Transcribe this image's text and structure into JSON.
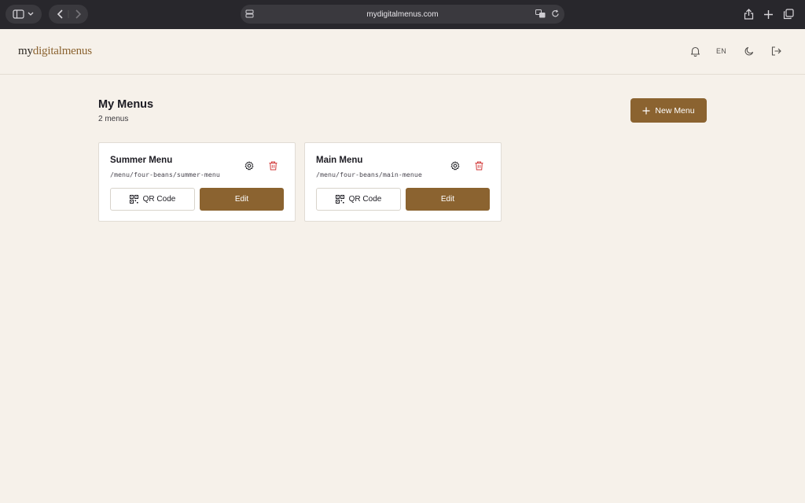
{
  "browser": {
    "url": "mydigitalmenus.com"
  },
  "header": {
    "logo_prefix": "my",
    "logo_accent": "digitalmenus",
    "language": "EN",
    "icons": [
      "bell-icon",
      "moon-icon",
      "logout-icon"
    ]
  },
  "main": {
    "title": "My Menus",
    "count_label": "2 menus",
    "new_menu_label": "New Menu"
  },
  "menus": [
    {
      "name": "Summer Menu",
      "path": "/menu/four-beans/summer-menu",
      "qr_label": "QR Code",
      "edit_label": "Edit"
    },
    {
      "name": "Main Menu",
      "path": "/menu/four-beans/main-menue",
      "qr_label": "QR Code",
      "edit_label": "Edit"
    }
  ],
  "colors": {
    "accent": "#8b6330",
    "background": "#f6f1ea",
    "danger": "#d23a3a"
  }
}
